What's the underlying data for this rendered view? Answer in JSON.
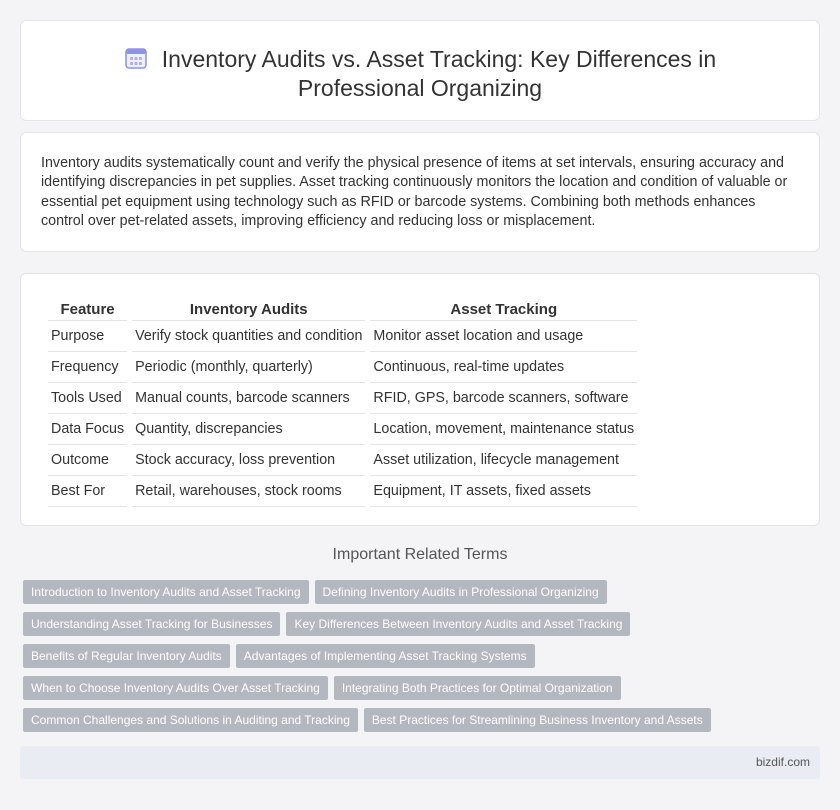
{
  "header": {
    "icon": "calendar-icon",
    "title_line1": "Inventory Audits vs. Asset Tracking: Key Differences in",
    "title_line2": "Professional Organizing"
  },
  "intro": {
    "text": "Inventory audits systematically count and verify the physical presence of items at set intervals, ensuring accuracy and identifying discrepancies in pet supplies. Asset tracking continuously monitors the location and condition of valuable or essential pet equipment using technology such as RFID or barcode systems. Combining both methods enhances control over pet-related assets, improving efficiency and reducing loss or misplacement."
  },
  "table": {
    "headers": [
      "Feature",
      "Inventory Audits",
      "Asset Tracking"
    ],
    "rows": [
      [
        "Purpose",
        "Verify stock quantities and condition",
        "Monitor asset location and usage"
      ],
      [
        "Frequency",
        "Periodic (monthly, quarterly)",
        "Continuous, real-time updates"
      ],
      [
        "Tools Used",
        "Manual counts, barcode scanners",
        "RFID, GPS, barcode scanners, software"
      ],
      [
        "Data Focus",
        "Quantity, discrepancies",
        "Location, movement, maintenance status"
      ],
      [
        "Outcome",
        "Stock accuracy, loss prevention",
        "Asset utilization, lifecycle management"
      ],
      [
        "Best For",
        "Retail, warehouses, stock rooms",
        "Equipment, IT assets, fixed assets"
      ]
    ]
  },
  "related": {
    "heading": "Important Related Terms",
    "tags": [
      [
        "Introduction to Inventory Audits and Asset Tracking",
        "Defining Inventory Audits in Professional Organizing"
      ],
      [
        "Understanding Asset Tracking for Businesses",
        "Key Differences Between Inventory Audits and Asset Tracking"
      ],
      [
        "Benefits of Regular Inventory Audits",
        "Advantages of Implementing Asset Tracking Systems"
      ],
      [
        "When to Choose Inventory Audits Over Asset Tracking",
        "Integrating Both Practices for Optimal Organization"
      ],
      [
        "Common Challenges and Solutions in Auditing and Tracking",
        "Best Practices for Streamlining Business Inventory and Assets"
      ]
    ]
  },
  "footer": {
    "text": "bizdif.com"
  },
  "colors": {
    "tag_bg": "#b3b8c0",
    "footer_bg": "#e9ecf3",
    "icon_accent": "#7b7fe0"
  }
}
